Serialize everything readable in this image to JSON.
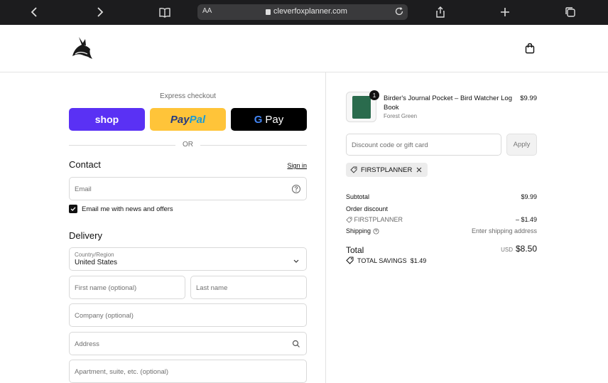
{
  "browser": {
    "text_size_label": "AA",
    "url": "cleverfoxplanner.com"
  },
  "express": {
    "label": "Express checkout",
    "shop_label": "shop",
    "paypal_part1": "Pay",
    "paypal_part2": "Pal",
    "gpay_g": "G",
    "gpay_label": "Pay",
    "or_label": "OR"
  },
  "contact": {
    "title": "Contact",
    "signin_label": "Sign in",
    "email_placeholder": "Email",
    "newsletter_label": "Email me with news and offers",
    "newsletter_checked": true
  },
  "delivery": {
    "title": "Delivery",
    "country_label": "Country/Region",
    "country_value": "United States",
    "first_name_placeholder": "First name (optional)",
    "last_name_placeholder": "Last name",
    "company_placeholder": "Company (optional)",
    "address_placeholder": "Address",
    "apartment_placeholder": "Apartment, suite, etc. (optional)"
  },
  "order": {
    "item": {
      "name": "Birder's Journal Pocket – Bird Watcher Log Book",
      "variant": "Forest Green",
      "price": "$9.99",
      "quantity": "1"
    },
    "discount_placeholder": "Discount code or gift card",
    "apply_label": "Apply",
    "applied_code": "FIRSTPLANNER",
    "subtotal_label": "Subtotal",
    "subtotal_value": "$9.99",
    "order_discount_label": "Order discount",
    "discount_code": "FIRSTPLANNER",
    "discount_value": "– $1.49",
    "shipping_label": "Shipping",
    "shipping_value": "Enter shipping address",
    "total_label": "Total",
    "currency": "USD",
    "total_value": "$8.50",
    "savings_label": "TOTAL SAVINGS",
    "savings_value": "$1.49"
  },
  "colors": {
    "shop": "#5a31f4",
    "paypal": "#ffc439",
    "gpay": "#000000"
  }
}
